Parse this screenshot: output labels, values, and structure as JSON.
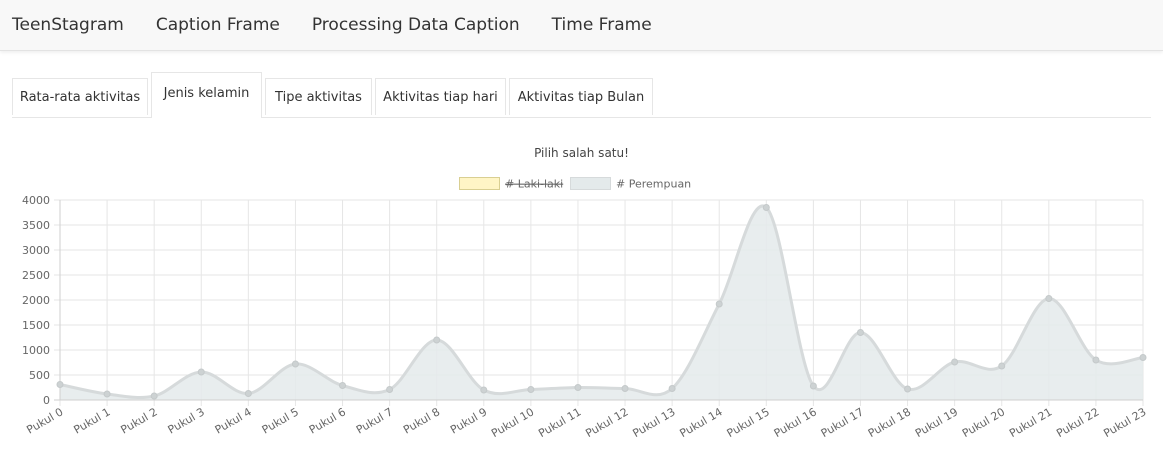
{
  "navbar": {
    "brand": "TeenStagram",
    "links": [
      "Caption Frame",
      "Processing Data Caption",
      "Time Frame"
    ]
  },
  "tabs": [
    {
      "label": "Rata-rata aktivitas",
      "active": false
    },
    {
      "label": "Jenis kelamin",
      "active": true
    },
    {
      "label": "Tipe aktivitas",
      "active": false
    },
    {
      "label": "Aktivitas tiap hari",
      "active": false
    },
    {
      "label": "Aktivitas tiap Bulan",
      "active": false
    }
  ],
  "chart_title": "Pilih salah satu!",
  "colors": {
    "laki_fill": "#fff5c6",
    "laki_border": "#d9cf92",
    "perempuan_fill": "#e4eaeb",
    "perempuan_line": "#d6dadb",
    "grid": "#e6e6e6"
  },
  "chart_data": {
    "type": "area",
    "title": "Pilih salah satu!",
    "categories": [
      "Pukul 0",
      "Pukul 1",
      "Pukul 2",
      "Pukul 3",
      "Pukul 4",
      "Pukul 5",
      "Pukul 6",
      "Pukul 7",
      "Pukul 8",
      "Pukul 9",
      "Pukul 10",
      "Pukul 11",
      "Pukul 12",
      "Pukul 13",
      "Pukul 14",
      "Pukul 15",
      "Pukul 16",
      "Pukul 17",
      "Pukul 18",
      "Pukul 19",
      "Pukul 20",
      "Pukul 21",
      "Pukul 22",
      "Pukul 23"
    ],
    "series": [
      {
        "name": "# Laki-laki",
        "hidden": true,
        "values": []
      },
      {
        "name": "# Perempuan",
        "values": [
          310,
          120,
          80,
          560,
          130,
          720,
          290,
          210,
          1200,
          200,
          210,
          250,
          230,
          230,
          1920,
          3850,
          280,
          1350,
          220,
          760,
          680,
          2030,
          800,
          850
        ]
      }
    ],
    "ylim": [
      0,
      4000
    ],
    "yticks": [
      0,
      500,
      1000,
      1500,
      2000,
      2500,
      3000,
      3500,
      4000
    ],
    "grid": true,
    "legend": "top-center"
  }
}
